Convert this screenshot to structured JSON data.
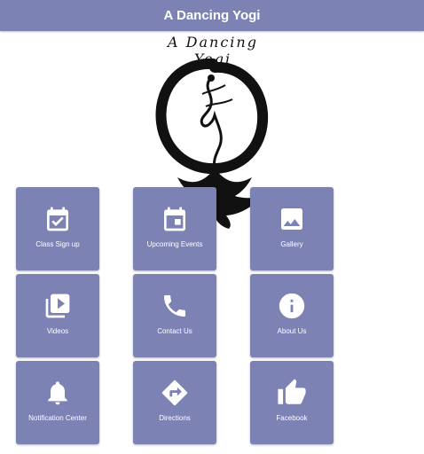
{
  "header": {
    "title": "A Dancing Yogi"
  },
  "logo": {
    "text": "A Dancing Yogi"
  },
  "tiles": [
    {
      "label": "Class Sign up",
      "icon": "calendar-check-icon"
    },
    {
      "label": "Upcoming Events",
      "icon": "calendar-icon"
    },
    {
      "label": "Gallery",
      "icon": "image-icon"
    },
    {
      "label": "Videos",
      "icon": "video-library-icon"
    },
    {
      "label": "Contact Us",
      "icon": "phone-icon"
    },
    {
      "label": "About Us",
      "icon": "info-icon"
    },
    {
      "label": "Notification Center",
      "icon": "bell-icon"
    },
    {
      "label": "Directions",
      "icon": "directions-icon"
    },
    {
      "label": "Facebook",
      "icon": "thumbs-up-icon"
    }
  ]
}
